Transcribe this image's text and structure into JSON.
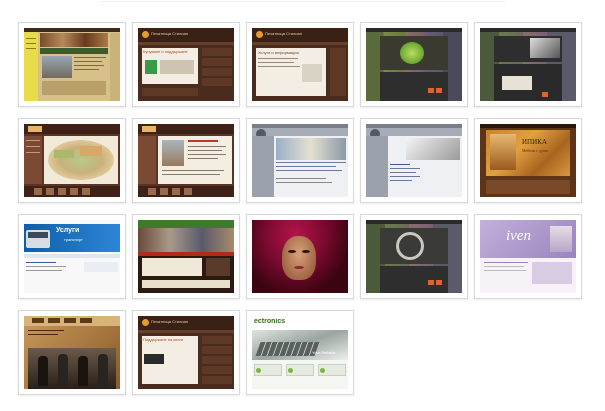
{
  "gallery": {
    "items": [
      {
        "title": ""
      },
      {
        "title": "Печатница Стилиан",
        "heading": "Купуване и поддържане"
      },
      {
        "title": "Печатница Стилиан",
        "heading": "Услуги и информация"
      },
      {
        "title": ""
      },
      {
        "title": ""
      },
      {
        "title": "",
        "heading": ""
      },
      {
        "title": "",
        "heading": ""
      },
      {
        "title": ""
      },
      {
        "title": ""
      },
      {
        "title": "ИПИКА",
        "subtitle": "Мебели с душа"
      },
      {
        "title": "Услуги",
        "subtitle": "транспорт"
      },
      {
        "title": ""
      },
      {
        "title": ""
      },
      {
        "title": ""
      },
      {
        "title": "iven"
      },
      {
        "title": ""
      },
      {
        "title": "Печатница Стилиан",
        "heading": "Поддържане на книги"
      },
      {
        "title": "ectronics",
        "subtitle": "Your Reliable"
      }
    ]
  },
  "colors": {
    "thumb_border": "#d8d8d8",
    "brown": "#4a2c1e",
    "orange": "#e89a2c",
    "purple": "#a08cbc"
  }
}
